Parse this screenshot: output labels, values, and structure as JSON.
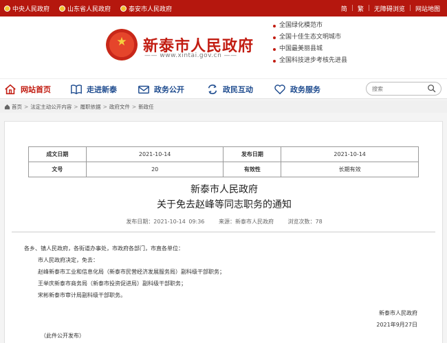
{
  "topbar": {
    "links": [
      "中央人民政府",
      "山东省人民政府",
      "泰安市人民政府"
    ],
    "tools": [
      "简",
      "繁",
      "无障碍浏览",
      "网站地图"
    ]
  },
  "header": {
    "site_title": "新泰市人民政府",
    "site_url": "www.xintai.gov.cn",
    "honors": [
      "全国绿化模范市",
      "全国十佳生态文明城市",
      "中国最美丽县城",
      "全国科技进步考核先进县"
    ]
  },
  "nav": {
    "items": [
      {
        "label": "网站首页",
        "icon": "home-icon"
      },
      {
        "label": "走进新泰",
        "icon": "book-icon"
      },
      {
        "label": "政务公开",
        "icon": "mail-icon"
      },
      {
        "label": "政民互动",
        "icon": "interact-icon"
      },
      {
        "label": "政务服务",
        "icon": "heart-icon"
      }
    ],
    "search_placeholder": "搜索"
  },
  "breadcrumb": [
    "首页",
    "法定主动公开内容",
    "履职依据",
    "政府文件",
    "新政任"
  ],
  "meta": {
    "k1": "成文日期",
    "v1": "2021-10-14",
    "k2": "发布日期",
    "v2": "2021-10-14",
    "k3": "文号",
    "v3": "20",
    "k4": "有效性",
    "v4": "长期有效"
  },
  "article": {
    "title_line1": "新泰市人民政府",
    "title_line2": "关于免去赵峰等同志职务的通知",
    "pub_date": "发布日期：2021-10-14 09:36",
    "source": "来源：新泰市人民政府",
    "views": "浏览次数：78",
    "salutation": "各乡、镇人民政府，各街道办事处，市政府各部门，市直各单位：",
    "lines": [
      "市人民政府决定，免去：",
      "赵峰新泰市工业和信息化局（新泰市民营经济发展服务局）副科级干部职务；",
      "王举庆新泰市商务局（新泰市投资促进局）副科级干部职务；",
      "宋彬新泰市审计局副科级干部职务。"
    ],
    "signer": "新泰市人民政府",
    "sign_date": "2021年9月27日",
    "note": "（此件公开发布）"
  },
  "colors": {
    "brand_red": "#b5170e",
    "nav_blue": "#1f4c8f"
  }
}
